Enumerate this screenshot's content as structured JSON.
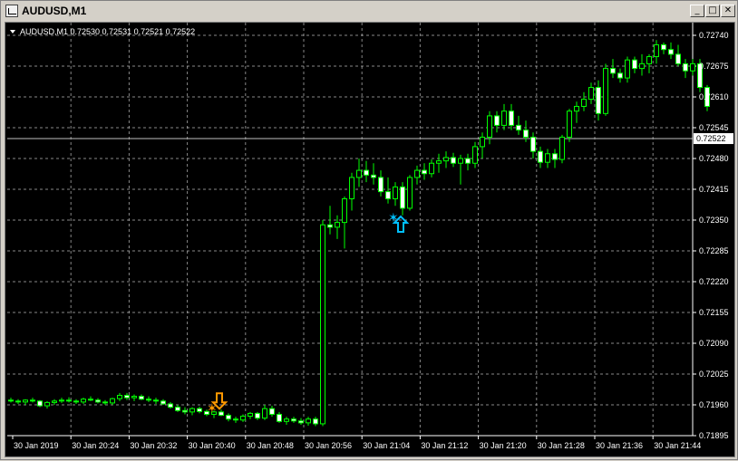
{
  "window": {
    "title": "AUDUSD,M1"
  },
  "title_buttons": {
    "minimize": "_",
    "maximize": "□",
    "close": "✕"
  },
  "chart_info": "AUDUSD,M1  0.72530 0.72531 0.72521 0.72522",
  "colors": {
    "background": "#000000",
    "grid": "#c0c0c0",
    "candle": "#00ff00",
    "axis_text": "#ffffff",
    "bid_line": "#c0c0c0",
    "buy_signal": "#00c0ff",
    "sell_signal": "#ff9900"
  },
  "chart_data": {
    "type": "candlestick",
    "symbol": "AUDUSD",
    "timeframe": "M1",
    "current_price": "0.72522",
    "ylim": [
      0.71895,
      0.7274
    ],
    "y_ticks": [
      "0.72740",
      "0.72675",
      "0.72610",
      "0.72545",
      "0.72480",
      "0.72415",
      "0.72350",
      "0.72285",
      "0.72220",
      "0.72155",
      "0.72090",
      "0.72025",
      "0.71960",
      "0.71895"
    ],
    "x_ticks": [
      "30 Jan 2019",
      "30 Jan 20:24",
      "30 Jan 20:32",
      "30 Jan 20:40",
      "30 Jan 20:48",
      "30 Jan 20:56",
      "30 Jan 21:04",
      "30 Jan 21:12",
      "30 Jan 21:20",
      "30 Jan 21:28",
      "30 Jan 21:36",
      "30 Jan 21:44"
    ],
    "candles": [
      [
        0.7197,
        0.71975,
        0.71965,
        0.71968
      ],
      [
        0.71968,
        0.71972,
        0.71962,
        0.71966
      ],
      [
        0.71966,
        0.71972,
        0.7196,
        0.7197
      ],
      [
        0.7197,
        0.71975,
        0.71965,
        0.71968
      ],
      [
        0.71968,
        0.7197,
        0.71955,
        0.71958
      ],
      [
        0.71958,
        0.71968,
        0.71952,
        0.71965
      ],
      [
        0.71965,
        0.71972,
        0.7196,
        0.71968
      ],
      [
        0.71968,
        0.71975,
        0.71964,
        0.7197
      ],
      [
        0.7197,
        0.71976,
        0.71965,
        0.71968
      ],
      [
        0.71968,
        0.71972,
        0.71962,
        0.71966
      ],
      [
        0.71966,
        0.71975,
        0.71962,
        0.71972
      ],
      [
        0.71972,
        0.71978,
        0.71968,
        0.7197
      ],
      [
        0.7197,
        0.71974,
        0.71963,
        0.71966
      ],
      [
        0.71966,
        0.7197,
        0.7196,
        0.71964
      ],
      [
        0.71964,
        0.71975,
        0.7196,
        0.71973
      ],
      [
        0.71973,
        0.71985,
        0.71968,
        0.7198
      ],
      [
        0.7198,
        0.71985,
        0.7197,
        0.71975
      ],
      [
        0.71975,
        0.71982,
        0.71968,
        0.71978
      ],
      [
        0.71978,
        0.71982,
        0.7197,
        0.71972
      ],
      [
        0.71972,
        0.71978,
        0.71966,
        0.7197
      ],
      [
        0.7197,
        0.71975,
        0.71962,
        0.71968
      ],
      [
        0.71968,
        0.71972,
        0.7196,
        0.71962
      ],
      [
        0.71962,
        0.71966,
        0.71952,
        0.71955
      ],
      [
        0.71955,
        0.7196,
        0.71945,
        0.71948
      ],
      [
        0.71948,
        0.71955,
        0.7194,
        0.71945
      ],
      [
        0.71945,
        0.71955,
        0.71938,
        0.71952
      ],
      [
        0.71952,
        0.71956,
        0.71942,
        0.71946
      ],
      [
        0.71946,
        0.7195,
        0.71936,
        0.7194
      ],
      [
        0.7194,
        0.71948,
        0.71932,
        0.71945
      ],
      [
        0.71945,
        0.7195,
        0.71936,
        0.71938
      ],
      [
        0.71938,
        0.71942,
        0.71925,
        0.7193
      ],
      [
        0.7193,
        0.71935,
        0.71922,
        0.71928
      ],
      [
        0.71928,
        0.7194,
        0.71924,
        0.71936
      ],
      [
        0.71936,
        0.71945,
        0.7193,
        0.71942
      ],
      [
        0.71942,
        0.71945,
        0.71928,
        0.71932
      ],
      [
        0.71932,
        0.7196,
        0.71928,
        0.71952
      ],
      [
        0.71952,
        0.71958,
        0.71935,
        0.7194
      ],
      [
        0.7194,
        0.71945,
        0.71922,
        0.71925
      ],
      [
        0.71925,
        0.71935,
        0.71918,
        0.7193
      ],
      [
        0.7193,
        0.71935,
        0.71922,
        0.71926
      ],
      [
        0.71926,
        0.71932,
        0.71918,
        0.71922
      ],
      [
        0.71922,
        0.71935,
        0.71916,
        0.7193
      ],
      [
        0.7193,
        0.71935,
        0.71915,
        0.7192
      ],
      [
        0.7192,
        0.7235,
        0.71915,
        0.7234
      ],
      [
        0.7234,
        0.7238,
        0.7232,
        0.72335
      ],
      [
        0.72335,
        0.7236,
        0.7231,
        0.72345
      ],
      [
        0.72345,
        0.724,
        0.7229,
        0.72395
      ],
      [
        0.72395,
        0.7245,
        0.7237,
        0.7244
      ],
      [
        0.7244,
        0.7248,
        0.7242,
        0.72455
      ],
      [
        0.72455,
        0.72475,
        0.7243,
        0.72445
      ],
      [
        0.72445,
        0.7247,
        0.72425,
        0.7244
      ],
      [
        0.7244,
        0.72455,
        0.724,
        0.7241
      ],
      [
        0.7241,
        0.7244,
        0.72385,
        0.72395
      ],
      [
        0.72395,
        0.7243,
        0.7238,
        0.7242
      ],
      [
        0.7242,
        0.7243,
        0.7236,
        0.72375
      ],
      [
        0.72375,
        0.72445,
        0.7237,
        0.7244
      ],
      [
        0.7244,
        0.72465,
        0.72425,
        0.72455
      ],
      [
        0.72455,
        0.7247,
        0.72435,
        0.72448
      ],
      [
        0.72448,
        0.72478,
        0.7244,
        0.7247
      ],
      [
        0.7247,
        0.7249,
        0.7245,
        0.72475
      ],
      [
        0.72475,
        0.72495,
        0.7246,
        0.72482
      ],
      [
        0.72482,
        0.72492,
        0.72462,
        0.7247
      ],
      [
        0.7247,
        0.72488,
        0.72425,
        0.7248
      ],
      [
        0.7248,
        0.7249,
        0.72455,
        0.7247
      ],
      [
        0.7247,
        0.72515,
        0.7246,
        0.72505
      ],
      [
        0.72505,
        0.72535,
        0.7248,
        0.72525
      ],
      [
        0.72525,
        0.7258,
        0.7251,
        0.7257
      ],
      [
        0.7257,
        0.7258,
        0.72535,
        0.7255
      ],
      [
        0.7255,
        0.72595,
        0.7254,
        0.7258
      ],
      [
        0.7258,
        0.72595,
        0.7254,
        0.7255
      ],
      [
        0.7255,
        0.7257,
        0.7253,
        0.7254
      ],
      [
        0.7254,
        0.7256,
        0.72515,
        0.72525
      ],
      [
        0.72525,
        0.72535,
        0.7248,
        0.72495
      ],
      [
        0.72495,
        0.72505,
        0.7246,
        0.72472
      ],
      [
        0.72472,
        0.725,
        0.7246,
        0.7249
      ],
      [
        0.7249,
        0.725,
        0.7246,
        0.72478
      ],
      [
        0.72478,
        0.7253,
        0.7247,
        0.72525
      ],
      [
        0.72525,
        0.72585,
        0.72515,
        0.7258
      ],
      [
        0.7258,
        0.726,
        0.72555,
        0.7259
      ],
      [
        0.7259,
        0.7262,
        0.7258,
        0.72605
      ],
      [
        0.72605,
        0.7264,
        0.72595,
        0.7263
      ],
      [
        0.7263,
        0.72645,
        0.7256,
        0.72575
      ],
      [
        0.72575,
        0.7268,
        0.7257,
        0.7267
      ],
      [
        0.7267,
        0.7269,
        0.7265,
        0.7266
      ],
      [
        0.7266,
        0.7267,
        0.7264,
        0.7265
      ],
      [
        0.7265,
        0.72695,
        0.7264,
        0.72688
      ],
      [
        0.72688,
        0.72695,
        0.7266,
        0.7267
      ],
      [
        0.7267,
        0.727,
        0.72655,
        0.7268
      ],
      [
        0.7268,
        0.727,
        0.7266,
        0.72695
      ],
      [
        0.72695,
        0.7273,
        0.7268,
        0.7272
      ],
      [
        0.7272,
        0.72725,
        0.727,
        0.7271
      ],
      [
        0.7271,
        0.72725,
        0.7269,
        0.727
      ],
      [
        0.727,
        0.7272,
        0.72675,
        0.7268
      ],
      [
        0.7268,
        0.7269,
        0.7265,
        0.72665
      ],
      [
        0.72665,
        0.7269,
        0.72655,
        0.7268
      ],
      [
        0.7268,
        0.7269,
        0.7262,
        0.7263
      ],
      [
        0.7263,
        0.72635,
        0.7258,
        0.7259
      ]
    ],
    "signals": [
      {
        "type": "buy",
        "candle_index": 53,
        "price": 0.7235
      },
      {
        "type": "sell",
        "candle_index": 28,
        "price": 0.7199
      }
    ]
  }
}
